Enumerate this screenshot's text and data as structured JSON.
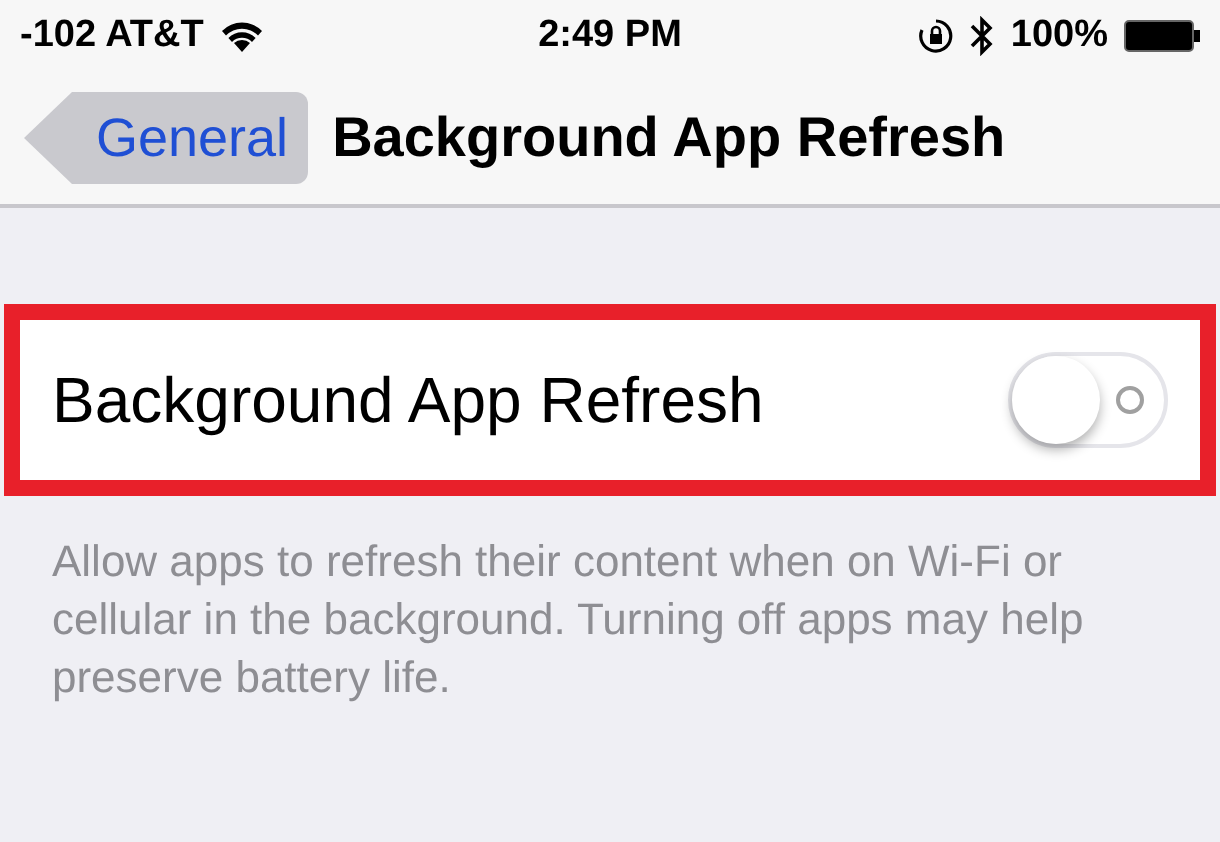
{
  "status_bar": {
    "carrier": "-102 AT&T",
    "time": "2:49 PM",
    "battery": "100%"
  },
  "nav": {
    "back": "General",
    "title": "Background App Refresh"
  },
  "setting": {
    "label": "Background App Refresh",
    "on": false,
    "highlighted": true
  },
  "footer": "Allow apps to refresh their content when on Wi-Fi or cellular in the background. Turning off apps may help preserve battery life."
}
